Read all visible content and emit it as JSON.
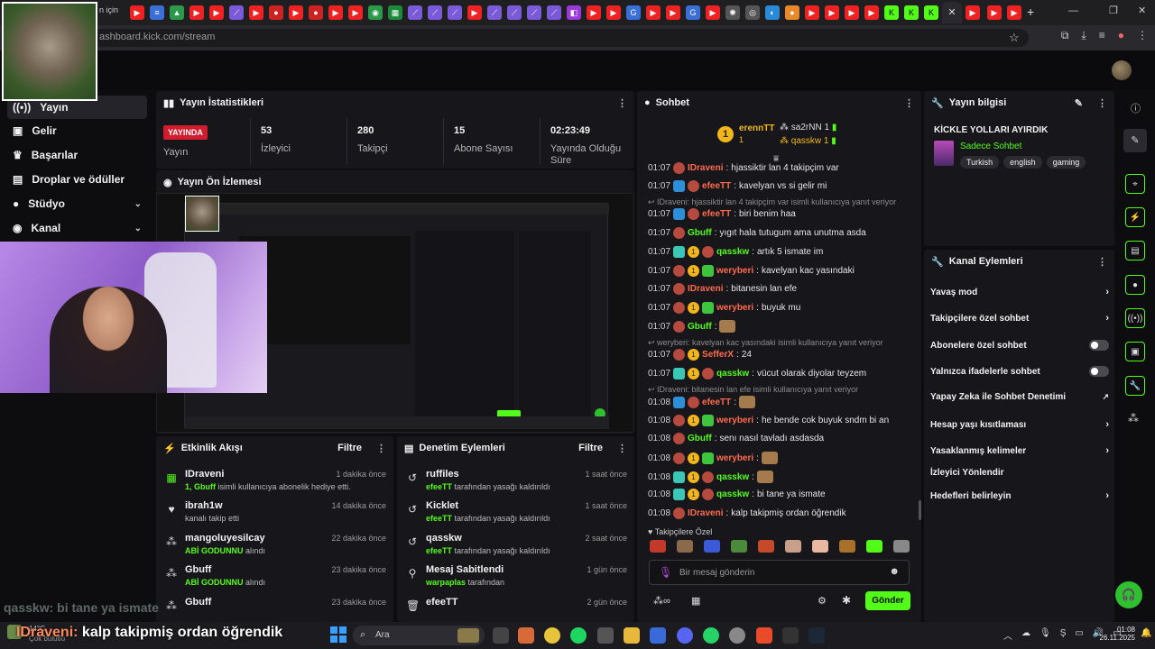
{
  "browser": {
    "url": "ashboard.kick.com/stream",
    "tab_partial": "n için"
  },
  "nav": [
    {
      "label": "Yayın",
      "icon": "live-icon"
    },
    {
      "label": "Gelir",
      "icon": "revenue-icon"
    },
    {
      "label": "Başarılar",
      "icon": "trophy-icon"
    },
    {
      "label": "Droplar ve ödüller",
      "icon": "gift-icon"
    },
    {
      "label": "Stüdyo",
      "icon": "studio-icon"
    },
    {
      "label": "Kanal",
      "icon": "channel-icon"
    }
  ],
  "stats": {
    "title": "Yayın İstatistikleri",
    "live_badge": "YAYINDA",
    "live_label": "Yayın",
    "viewers_value": "53",
    "viewers_label": "İzleyici",
    "followers_value": "280",
    "followers_label": "Takipçi",
    "subs_value": "15",
    "subs_label": "Abone Sayısı",
    "uptime_value": "02:23:49",
    "uptime_label": "Yayında Olduğu Süre"
  },
  "preview": {
    "title": "Yayın Ön İzlemesi"
  },
  "activity": {
    "title": "Etkinlik Akışı",
    "filter": "Filtre",
    "items": [
      {
        "user": "IDraveni",
        "sub_pre": "1, ",
        "sub_bold": "Gbuff",
        "sub_post": " isimli kullanıcıya abonelik hediye etti.",
        "time": "1 dakika önce"
      },
      {
        "user": "ibrah1w",
        "sub_pre": "kanalı takip etti",
        "sub_bold": "",
        "sub_post": "",
        "time": "14 dakika önce"
      },
      {
        "user": "mangoluyesilcay",
        "sub_pre": "",
        "sub_bold": "ABİ GODUNNU",
        "sub_post": " alındı",
        "time": "22 dakika önce"
      },
      {
        "user": "Gbuff",
        "sub_pre": "",
        "sub_bold": "ABİ GODUNNU",
        "sub_post": " alındı",
        "time": "23 dakika önce"
      },
      {
        "user": "Gbuff",
        "sub_pre": "",
        "sub_bold": "",
        "sub_post": "",
        "time": "23 dakika önce"
      }
    ]
  },
  "moderation": {
    "title": "Denetim Eylemleri",
    "filter": "Filtre",
    "items": [
      {
        "user": "ruffiles",
        "by": "efeeTT",
        "action": " tarafından yasağı kaldırıldı",
        "time": "1 saat önce"
      },
      {
        "user": "Kicklet",
        "by": "efeeTT",
        "action": " tarafından yasağı kaldırıldı",
        "time": "1 saat önce"
      },
      {
        "user": "qasskw",
        "by": "efeeTT",
        "action": " tarafından yasağı kaldırıldı",
        "time": "2 saat önce"
      },
      {
        "user": "Mesaj Sabitlendi",
        "by": "warpaplas",
        "action": " tarafından",
        "time": "1 gün önce"
      },
      {
        "user": "efeeTT",
        "by": "",
        "action": "",
        "time": "2 gün önce"
      }
    ]
  },
  "chat": {
    "title": "Sohbet",
    "top_gifter": {
      "name": "erennTT",
      "count": "1"
    },
    "gifters": [
      {
        "name": "sa2rNN",
        "count": "1"
      },
      {
        "name": "qasskw",
        "count": "1"
      }
    ],
    "messages": [
      {
        "type": "msg",
        "time": "01:07",
        "user": "IDraveni",
        "color": "#ff6a4d",
        "text": "hjassiktir lan 4 takipçim var"
      },
      {
        "type": "msg",
        "time": "01:07",
        "user": "efeeTT",
        "color": "#ff6a4d",
        "text": "kavelyan vs si gelir mi"
      },
      {
        "type": "reply",
        "text": "IDraveni: hjassiktir lan 4 takipçim var isimli kullanıcıya yanıt veriyor"
      },
      {
        "type": "msg",
        "time": "01:07",
        "user": "efeeTT",
        "color": "#ff6a4d",
        "text": "biri benim haa"
      },
      {
        "type": "msg",
        "time": "01:07",
        "user": "Gbuff",
        "color": "#53fc18",
        "text": "yıgıt hala tutugum ama unutma asda"
      },
      {
        "type": "msg",
        "time": "01:07",
        "user": "qasskw",
        "color": "#53fc18",
        "text": "artık 5 ismate im"
      },
      {
        "type": "msg",
        "time": "01:07",
        "user": "weryberi",
        "color": "#ff6a4d",
        "text": "kavelyan kac yasındaki"
      },
      {
        "type": "msg",
        "time": "01:07",
        "user": "IDraveni",
        "color": "#ff6a4d",
        "text": "bitanesin lan efe"
      },
      {
        "type": "msg",
        "time": "01:07",
        "user": "weryberi",
        "color": "#ff6a4d",
        "text": "buyuk mu"
      },
      {
        "type": "msg",
        "time": "01:07",
        "user": "Gbuff",
        "color": "#53fc18",
        "text": ""
      },
      {
        "type": "reply",
        "text": "weryberi: kavelyan kac yasındaki isimli kullanıcıya yanıt veriyor"
      },
      {
        "type": "msg",
        "time": "01:07",
        "user": "SefferX",
        "color": "#ff6a4d",
        "text": "24"
      },
      {
        "type": "msg",
        "time": "01:07",
        "user": "qasskw",
        "color": "#53fc18",
        "text": "vücut olarak diyolar teyzem"
      },
      {
        "type": "reply",
        "text": "IDraveni: bitanesin lan efe isimli kullanıcıya yanıt veriyor"
      },
      {
        "type": "msg",
        "time": "01:08",
        "user": "efeeTT",
        "color": "#ff6a4d",
        "text": ""
      },
      {
        "type": "msg",
        "time": "01:08",
        "user": "weryberi",
        "color": "#ff6a4d",
        "text": "he bende cok buyuk sndm bi an"
      },
      {
        "type": "msg",
        "time": "01:08",
        "user": "Gbuff",
        "color": "#53fc18",
        "text": "senı nasıl tavladı asdasda"
      },
      {
        "type": "msg",
        "time": "01:08",
        "user": "weryberi",
        "color": "#ff6a4d",
        "text": ""
      },
      {
        "type": "msg",
        "time": "01:08",
        "user": "qasskw",
        "color": "#53fc18",
        "text": ""
      },
      {
        "type": "msg",
        "time": "01:08",
        "user": "qasskw",
        "color": "#53fc18",
        "text": "bi tane ya ismate"
      },
      {
        "type": "msg",
        "time": "01:08",
        "user": "IDraveni",
        "color": "#ff6a4d",
        "text": "kalp takipmiş ordan öğrendik"
      }
    ],
    "followers_only": "Takipçilere Özel",
    "input_placeholder": "Bir mesaj gönderin",
    "send": "Gönder"
  },
  "stream_info": {
    "title": "Yayın bilgisi",
    "stream_title": "KİCKLE YOLLARI AYIRDIK",
    "category": "Sadece Sohbet",
    "tags": [
      "Turkish",
      "english",
      "gaming"
    ]
  },
  "channel_actions": {
    "title": "Kanal Eylemleri",
    "rows": [
      {
        "label": "Yavaş mod",
        "kind": "arrow"
      },
      {
        "label": "Takipçilere özel sohbet",
        "kind": "arrow"
      },
      {
        "label": "Abonelere özel sohbet",
        "kind": "toggle"
      },
      {
        "label": "Yalnızca ifadelerle sohbet",
        "kind": "toggle"
      },
      {
        "label": "Yapay Zeka ile Sohbet Denetimi",
        "kind": "ext"
      },
      {
        "label": "Hesap yaşı kısıtlaması",
        "kind": "arrow"
      },
      {
        "label": "Yasaklanmış kelimeler",
        "kind": "arrow"
      },
      {
        "label": "İzleyici Yönlendir",
        "kind": "none"
      },
      {
        "label": "Hedefleri belirleyin",
        "kind": "arrow"
      }
    ]
  },
  "overlay": {
    "chat1_user": "qasskw:",
    "chat1_text": "bi tane ya ismate",
    "chat2_user": "IDraveni:",
    "chat2_text": "kalp takipmiş ordan öğrendik"
  },
  "taskbar": {
    "search": "Ara",
    "weather": "14°C",
    "weather_desc": "Çok bulutlu",
    "time": "01:08",
    "date": "26.11.2025"
  },
  "colors": {
    "kick_green": "#53fc18",
    "live_red": "#d11c2d",
    "panel": "#17171b"
  }
}
